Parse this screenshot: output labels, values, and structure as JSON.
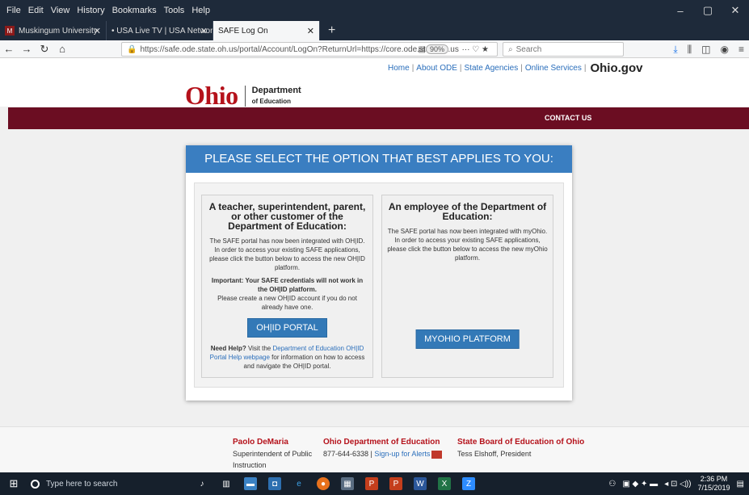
{
  "browser": {
    "menu": [
      "File",
      "Edit",
      "View",
      "History",
      "Bookmarks",
      "Tools",
      "Help"
    ],
    "window_controls": [
      "–",
      "▢",
      "✕"
    ],
    "tabs": [
      {
        "label": "Muskingum University",
        "favicon": "M"
      },
      {
        "label": "• USA Live TV | USA Network",
        "favicon": ""
      },
      {
        "label": "SAFE Log On",
        "favicon": ""
      }
    ],
    "new_tab": "+",
    "url": "https://safe.ode.state.oh.us/portal/Account/LogOn?ReturnUrl=https://core.ode.state.oh.us",
    "zoom": "90%",
    "search_placeholder": "Search"
  },
  "site": {
    "top_links": [
      "Home",
      "About ODE",
      "State Agencies",
      "Online Services"
    ],
    "ohio_gov": "Ohio.gov",
    "logo_ohio": "Ohio",
    "logo_dept_line1": "Department",
    "logo_dept_line2": "of Education",
    "contact_us": "CONTACT US"
  },
  "panel": {
    "heading": "PLEASE SELECT THE OPTION THAT BEST APPLIES TO YOU:",
    "left": {
      "title": "A teacher, superintendent, parent, or other customer of the Department of Education:",
      "body": "The SAFE portal has now been integrated with OH|ID. In order to access your existing SAFE applications, please click the button below to access the new OH|ID platform.",
      "important": "Important: Your SAFE credentials will not work in the OH|ID platform.",
      "create": "Please create a new OH|ID account if you do not already have one.",
      "button": "OH|ID PORTAL",
      "help_bold": "Need Help?",
      "help_pre": " Visit the ",
      "help_link": "Department of Education OH|ID Portal Help webpage",
      "help_post": " for information on how to access and navigate the OH|ID portal."
    },
    "right": {
      "title": "An employee of the Department of Education:",
      "body": "The SAFE portal has now been integrated with myOhio. In order to access your existing SAFE applications, please click the button below to access the new myOhio platform.",
      "button": "MYOHIO PLATFORM"
    }
  },
  "footer": {
    "col1_title": "Paolo DeMaria",
    "col1_line": "Superintendent of Public",
    "col1_line2": "Instruction",
    "col2_title": "Ohio Department of Education",
    "col2_phone": "877-644-6338 | ",
    "col2_link": "Sign-up for Alerts",
    "col3_title": "State Board of Education of Ohio",
    "col3_line": "Tess Elshoff, President"
  },
  "taskbar": {
    "search_placeholder": "Type here to search",
    "time": "2:36 PM",
    "date": "7/15/2019"
  },
  "colors": {
    "ohio_red": "#b5121b",
    "maroon_bar": "#6b0d22",
    "panel_blue": "#3a7ec1",
    "button_blue": "#3379b7"
  }
}
